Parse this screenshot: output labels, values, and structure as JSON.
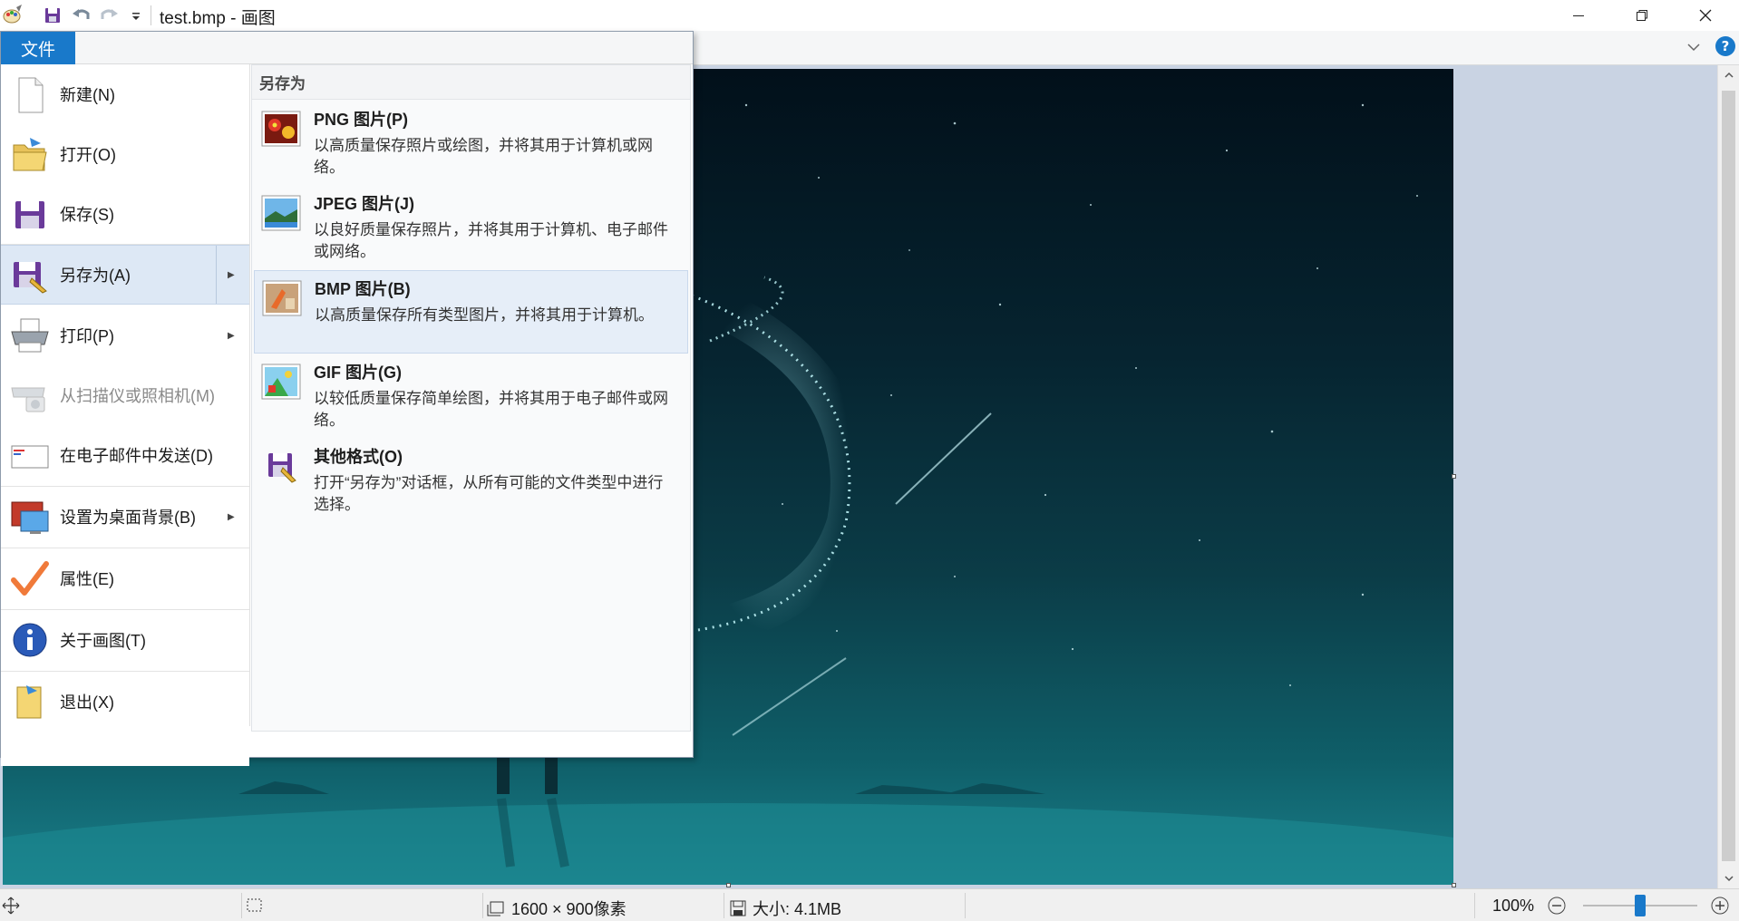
{
  "window": {
    "title": "test.bmp - 画图"
  },
  "ribbon": {
    "file_tab": "文件",
    "help": "?"
  },
  "file_menu": {
    "items": [
      {
        "label": "新建(N)",
        "icon": "new-file-icon"
      },
      {
        "label": "打开(O)",
        "icon": "open-folder-icon"
      },
      {
        "label": "保存(S)",
        "icon": "save-disk-icon"
      },
      {
        "label": "另存为(A)",
        "icon": "save-as-icon",
        "has_submenu": true,
        "selected": true
      },
      {
        "label": "打印(P)",
        "icon": "printer-icon",
        "has_submenu": true
      },
      {
        "label": "从扫描仪或照相机(M)",
        "icon": "scanner-icon",
        "disabled": true
      },
      {
        "label": "在电子邮件中发送(D)",
        "icon": "email-icon"
      },
      {
        "label": "设置为桌面背景(B)",
        "icon": "desktop-background-icon",
        "has_submenu": true
      },
      {
        "label": "属性(E)",
        "icon": "properties-check-icon"
      },
      {
        "label": "关于画图(T)",
        "icon": "info-icon"
      },
      {
        "label": "退出(X)",
        "icon": "exit-icon"
      }
    ]
  },
  "save_as_submenu": {
    "title": "另存为",
    "items": [
      {
        "title": "PNG 图片(P)",
        "desc": "以高质量保存照片或绘图，并将其用于计算机或网络。",
        "icon": "png-image-icon"
      },
      {
        "title": "JPEG 图片(J)",
        "desc": "以良好质量保存照片，并将其用于计算机、电子邮件或网络。",
        "icon": "jpeg-image-icon"
      },
      {
        "title": "BMP 图片(B)",
        "desc": "以高质量保存所有类型图片，并将其用于计算机。",
        "icon": "bmp-image-icon",
        "highlighted": true
      },
      {
        "title": "GIF 图片(G)",
        "desc": "以较低质量保存简单绘图，并将其用于电子邮件或网络。",
        "icon": "gif-image-icon"
      },
      {
        "title": "其他格式(O)",
        "desc": "打开“另存为”对话框，从所有可能的文件类型中进行选择。",
        "icon": "other-formats-icon"
      }
    ]
  },
  "status_bar": {
    "image_size": "1600 × 900像素",
    "file_size": "大小: 4.1MB",
    "zoom": "100%",
    "zoom_level": 1.0
  },
  "colors": {
    "file_tab_blue": "#1979ca",
    "menu_selected": "#dde8f5",
    "workspace_bg": "#c9d3e3"
  }
}
